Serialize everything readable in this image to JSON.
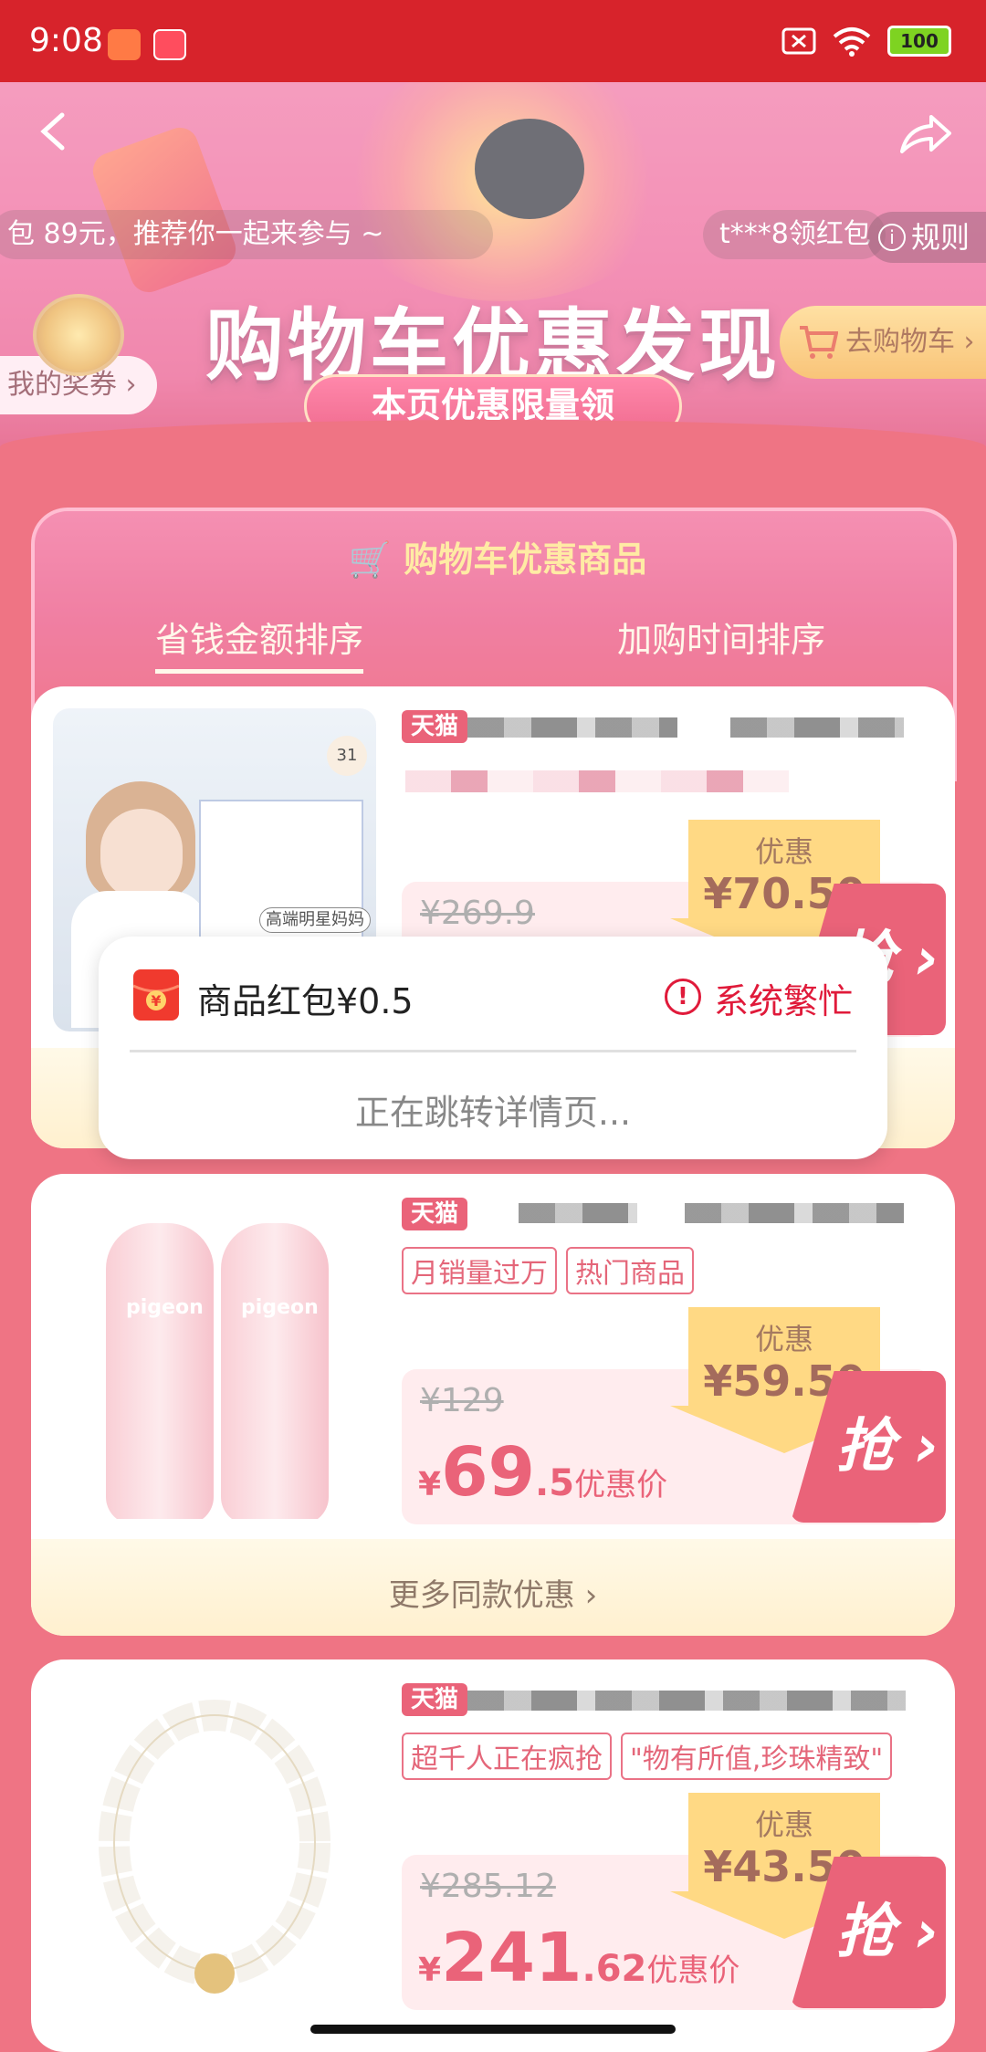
{
  "status_bar": {
    "time": "9:08",
    "battery": "100"
  },
  "banner": {
    "ticker_left": "包 89元，推荐你一起来参与 ~",
    "ticker_right": "t***8领红包",
    "rules_label": "规则",
    "my_coupons": "我的奖券",
    "title": "购物车优惠发现",
    "subtitle": "本页优惠限量领",
    "go_cart": "去购物车"
  },
  "panel": {
    "title": "购物车优惠商品",
    "tabs": [
      {
        "label": "省钱金额排序"
      },
      {
        "label": "加购时间排序"
      }
    ]
  },
  "products": [
    {
      "badge": "天猫",
      "tags": [],
      "original_price": "¥269.9",
      "save_label": "优惠",
      "save_amount": "¥70.50",
      "grab_label": "抢",
      "thumb_badge": "31",
      "thumb_caption": "高端明星妈妈"
    },
    {
      "badge": "天猫",
      "tags": [
        "月销量过万",
        "热门商品"
      ],
      "original_price": "¥129",
      "price_currency": "¥",
      "price_int": "69",
      "price_dec": ".5",
      "price_label": "优惠价",
      "save_label": "优惠",
      "save_amount": "¥59.50",
      "grab_label": "抢",
      "more_label": "更多同款优惠",
      "thumb_brand": "pigeon"
    },
    {
      "badge": "天猫",
      "tags": [
        "超千人正在疯抢",
        "\"物有所值,珍珠精致\""
      ],
      "original_price": "¥285.12",
      "price_currency": "¥",
      "price_int": "241",
      "price_dec": ".62",
      "price_label": "优惠价",
      "save_label": "优惠",
      "save_amount": "¥43.50",
      "grab_label": "抢"
    }
  ],
  "modal": {
    "title": "商品红包¥0.5",
    "status": "系统繁忙",
    "message": "正在跳转详情页..."
  },
  "colors": {
    "accent": "#e01a3a",
    "status_bar": "#d7232b",
    "page_bg": "#e8334a"
  }
}
